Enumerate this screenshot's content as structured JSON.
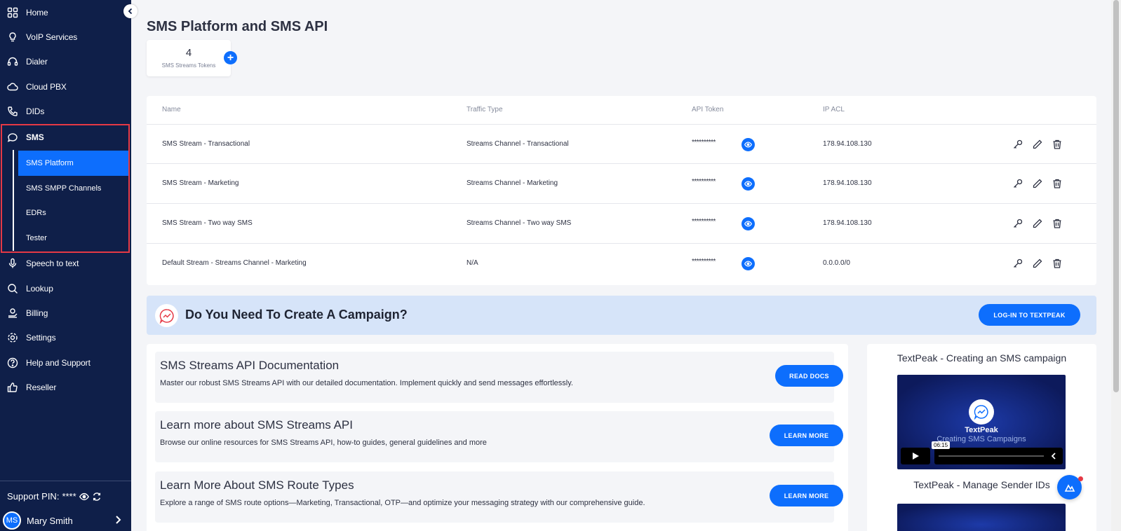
{
  "sidebar": {
    "items": [
      {
        "label": "Home",
        "icon": "grid-icon"
      },
      {
        "label": "VoIP Services",
        "icon": "lightbulb-icon"
      },
      {
        "label": "Dialer",
        "icon": "headset-icon"
      },
      {
        "label": "Cloud PBX",
        "icon": "cloud-icon"
      },
      {
        "label": "DIDs",
        "icon": "phone-icon"
      },
      {
        "label": "SMS",
        "icon": "chat-icon"
      },
      {
        "label": "Speech to text",
        "icon": "microphone-icon"
      },
      {
        "label": "Lookup",
        "icon": "search-icon"
      },
      {
        "label": "Billing",
        "icon": "billing-icon"
      },
      {
        "label": "Settings",
        "icon": "gear-icon"
      },
      {
        "label": "Help and Support",
        "icon": "question-icon"
      },
      {
        "label": "Reseller",
        "icon": "thumbs-up-icon"
      }
    ],
    "sms_sub": [
      {
        "label": "SMS Platform",
        "active": true
      },
      {
        "label": "SMS SMPP Channels",
        "active": false
      },
      {
        "label": "EDRs",
        "active": false
      },
      {
        "label": "Tester",
        "active": false
      }
    ],
    "support_pin_label": "Support PIN:",
    "support_pin_value": "****",
    "user_initials": "MS",
    "user_name": "Mary Smith"
  },
  "page": {
    "title": "SMS Platform and SMS API",
    "token_count": "4",
    "token_label": "SMS Streams Tokens"
  },
  "table": {
    "headers": {
      "name": "Name",
      "traffic": "Traffic Type",
      "token": "API Token",
      "acl": "IP ACL"
    },
    "rows": [
      {
        "name": "SMS Stream - Transactional",
        "traffic": "Streams Channel - Transactional",
        "token": "**********",
        "acl": "178.94.108.130"
      },
      {
        "name": "SMS Stream - Marketing",
        "traffic": "Streams Channel - Marketing",
        "token": "**********",
        "acl": "178.94.108.130"
      },
      {
        "name": "SMS Stream - Two way SMS",
        "traffic": "Streams Channel - Two way SMS",
        "token": "**********",
        "acl": "178.94.108.130"
      },
      {
        "name": "Default Stream - Streams Channel - Marketing",
        "traffic": "N/A",
        "token": "**********",
        "acl": "0.0.0.0/0"
      }
    ]
  },
  "campaign": {
    "title": "Do You Need To Create A Campaign?",
    "button": "LOG-IN TO TEXTPEAK"
  },
  "resources": [
    {
      "title": "SMS Streams API Documentation",
      "desc": "Master our robust SMS Streams API with our detailed documentation. Implement quickly and send messages effortlessly.",
      "button": "READ DOCS"
    },
    {
      "title": "Learn more about SMS Streams API",
      "desc": "Browse our online resources for SMS Streams API, how-to guides, general guidelines and more",
      "button": "LEARN MORE"
    },
    {
      "title": "Learn More About SMS Route Types",
      "desc": "Explore a range of SMS route options—Marketing, Transactional, OTP—and optimize your messaging strategy with our comprehensive guide.",
      "button": "LEARN MORE"
    }
  ],
  "videos": [
    {
      "title": "TextPeak - Creating an SMS campaign",
      "brand": "TextPeak",
      "subtitle": "Creating SMS Campaigns",
      "duration": "06:15"
    },
    {
      "title": "TextPeak - Manage Sender IDs"
    }
  ],
  "colors": {
    "sidebar_bg": "#0f1f49",
    "accent": "#0d6efd",
    "highlight_border": "#e53945",
    "banner_bg": "#d6e4f9"
  }
}
